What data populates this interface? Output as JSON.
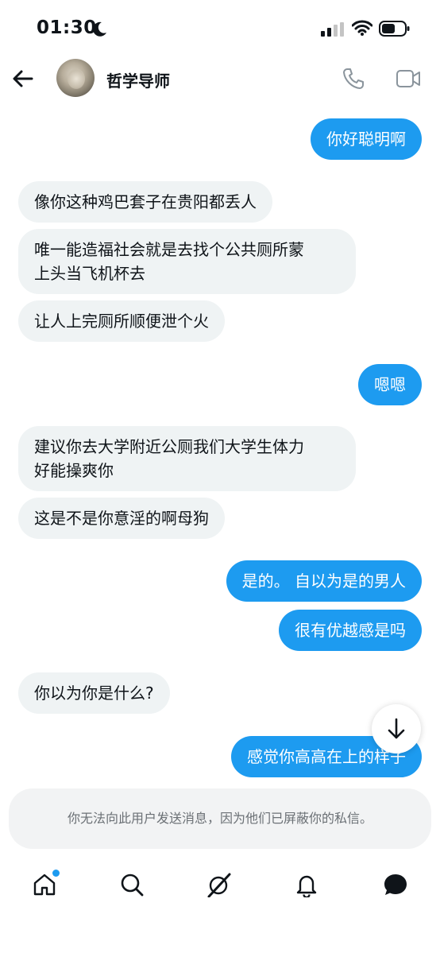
{
  "status_bar": {
    "time": "01:30"
  },
  "header": {
    "title": "哲学导师"
  },
  "messages": [
    {
      "dir": "out",
      "text": "你好聪明啊"
    },
    {
      "dir": "in",
      "text": "像你这种鸡巴套子在贵阳都丢人"
    },
    {
      "dir": "in",
      "text": "唯一能造福社会就是去找个公共厕所蒙\n上头当飞机杯去"
    },
    {
      "dir": "in",
      "text": "让人上完厕所顺便泄个火"
    },
    {
      "dir": "out",
      "text": "嗯嗯"
    },
    {
      "dir": "in",
      "text": "建议你去大学附近公厕我们大学生体力\n好能操爽你"
    },
    {
      "dir": "in",
      "text": "这是不是你意淫的啊母狗"
    },
    {
      "dir": "out",
      "text": "是的。 自以为是的男人"
    },
    {
      "dir": "out",
      "text": "很有优越感是吗"
    },
    {
      "dir": "in",
      "text": "你以为你是什么?"
    },
    {
      "dir": "out",
      "text": "感觉你高高在上的样子"
    }
  ],
  "composer": {
    "notice": "你无法向此用户发送消息，因为他们已屏蔽你的私信。"
  },
  "tabbar": {
    "items": [
      "home-icon",
      "search-icon",
      "grok-icon",
      "notifications-icon",
      "messages-icon"
    ]
  },
  "colors": {
    "accent": "#1d9bf0",
    "incoming_bg": "#eff3f4"
  }
}
